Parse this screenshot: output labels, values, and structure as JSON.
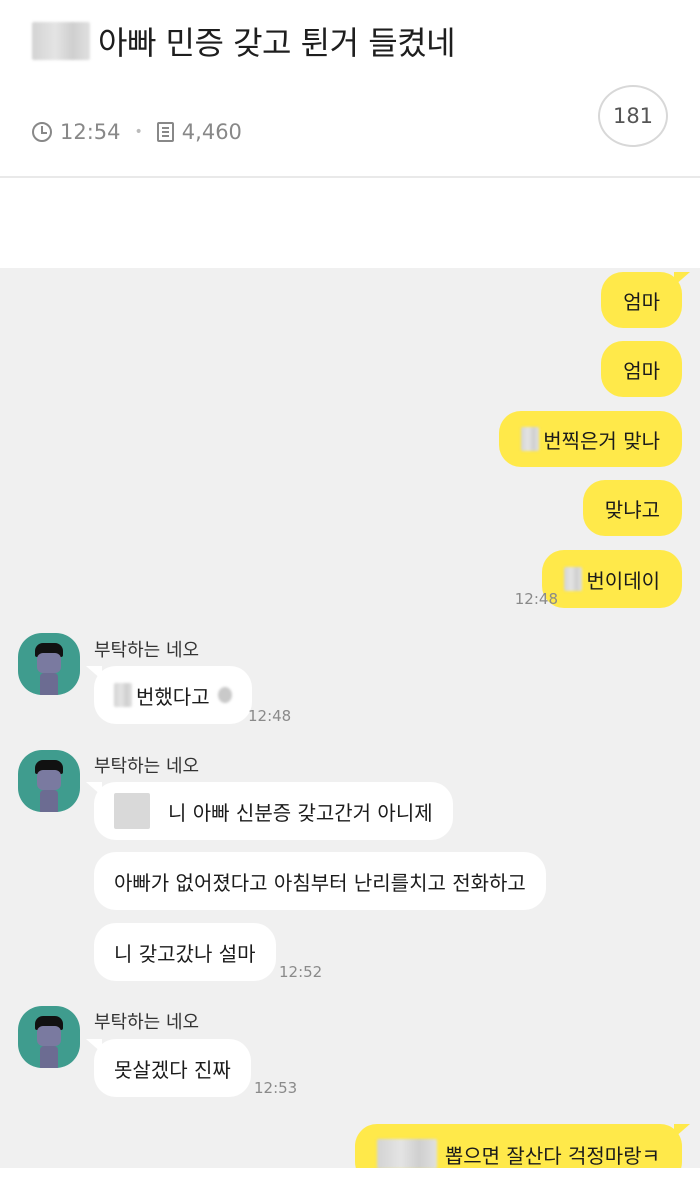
{
  "post": {
    "title": "아빠 민증 갖고 튄거 들켰네",
    "time": "12:54",
    "views": "4,460",
    "comment_count": "181"
  },
  "chat": {
    "outgoing": [
      {
        "text": "엄마"
      },
      {
        "text": "엄마"
      },
      {
        "text": "번찍은거 맞나"
      },
      {
        "text": "맞냐고"
      },
      {
        "text": "번이데이"
      },
      {
        "text": "뽑으면 잘산다 걱정마랑ㅋ"
      }
    ],
    "outgoing_time": "12:48",
    "groups": [
      {
        "sender": "부탁하는 네오",
        "messages": [
          "번했다고"
        ],
        "time": "12:48"
      },
      {
        "sender": "부탁하는 네오",
        "messages": [
          "니 아빠 신분증 갖고간거 아니제",
          "아빠가 없어졌다고 아침부터 난리를치고 전화하고",
          "니 갖고갔나 설마"
        ],
        "time": "12:52"
      },
      {
        "sender": "부탁하는 네오",
        "messages": [
          "못살겠다 진짜"
        ],
        "time": "12:53"
      }
    ]
  },
  "colors": {
    "outgoing_bubble": "#ffe94a",
    "incoming_bubble": "#ffffff",
    "chat_background": "#f0f0f0",
    "avatar": "#3f9c8e"
  },
  "icons": {
    "time": "clock-icon",
    "views": "document-icon"
  }
}
